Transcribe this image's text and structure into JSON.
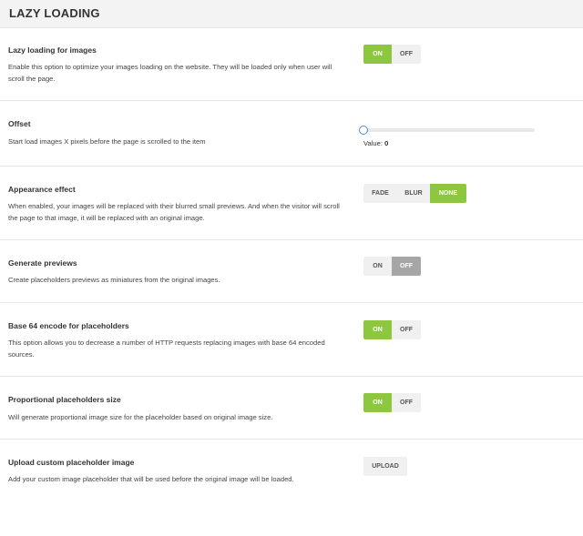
{
  "header": {
    "title": "LAZY LOADING"
  },
  "settings": {
    "lazy_images": {
      "label": "Lazy loading for images",
      "description": "Enable this option to optimize your images loading on the website. They will be loaded only when user will scroll the page.",
      "on": "ON",
      "off": "OFF",
      "selected": "ON"
    },
    "offset": {
      "label": "Offset",
      "description": "Start load images X pixels before the page is scrolled to the item",
      "value_label": "Value:",
      "value": "0"
    },
    "appearance": {
      "label": "Appearance effect",
      "description": "When enabled, your images will be replaced with their blurred small previews. And when the visitor will scroll the page to that image, it will be replaced with an original image.",
      "options": [
        "FADE",
        "BLUR",
        "NONE"
      ],
      "selected": "NONE"
    },
    "previews": {
      "label": "Generate previews",
      "description": "Create placeholders previews as miniatures from the original images.",
      "on": "ON",
      "off": "OFF",
      "selected": "OFF"
    },
    "base64": {
      "label": "Base 64 encode for placeholders",
      "description": "This option allows you to decrease a number of HTTP requests replacing images with base 64 encoded sources.",
      "on": "ON",
      "off": "OFF",
      "selected": "ON"
    },
    "proportional": {
      "label": "Proportional placeholders size",
      "description": "Will generate proportional image size for the placeholder based on original image size.",
      "on": "ON",
      "off": "OFF",
      "selected": "ON"
    },
    "upload": {
      "label": "Upload custom placeholder image",
      "description": "Add your custom image placeholder that will be used before the original image will be loaded.",
      "button": "UPLOAD"
    }
  },
  "colors": {
    "accent": "#8dc63f",
    "off_active": "#a6a6a6",
    "slider_handle": "#5b86c2"
  }
}
